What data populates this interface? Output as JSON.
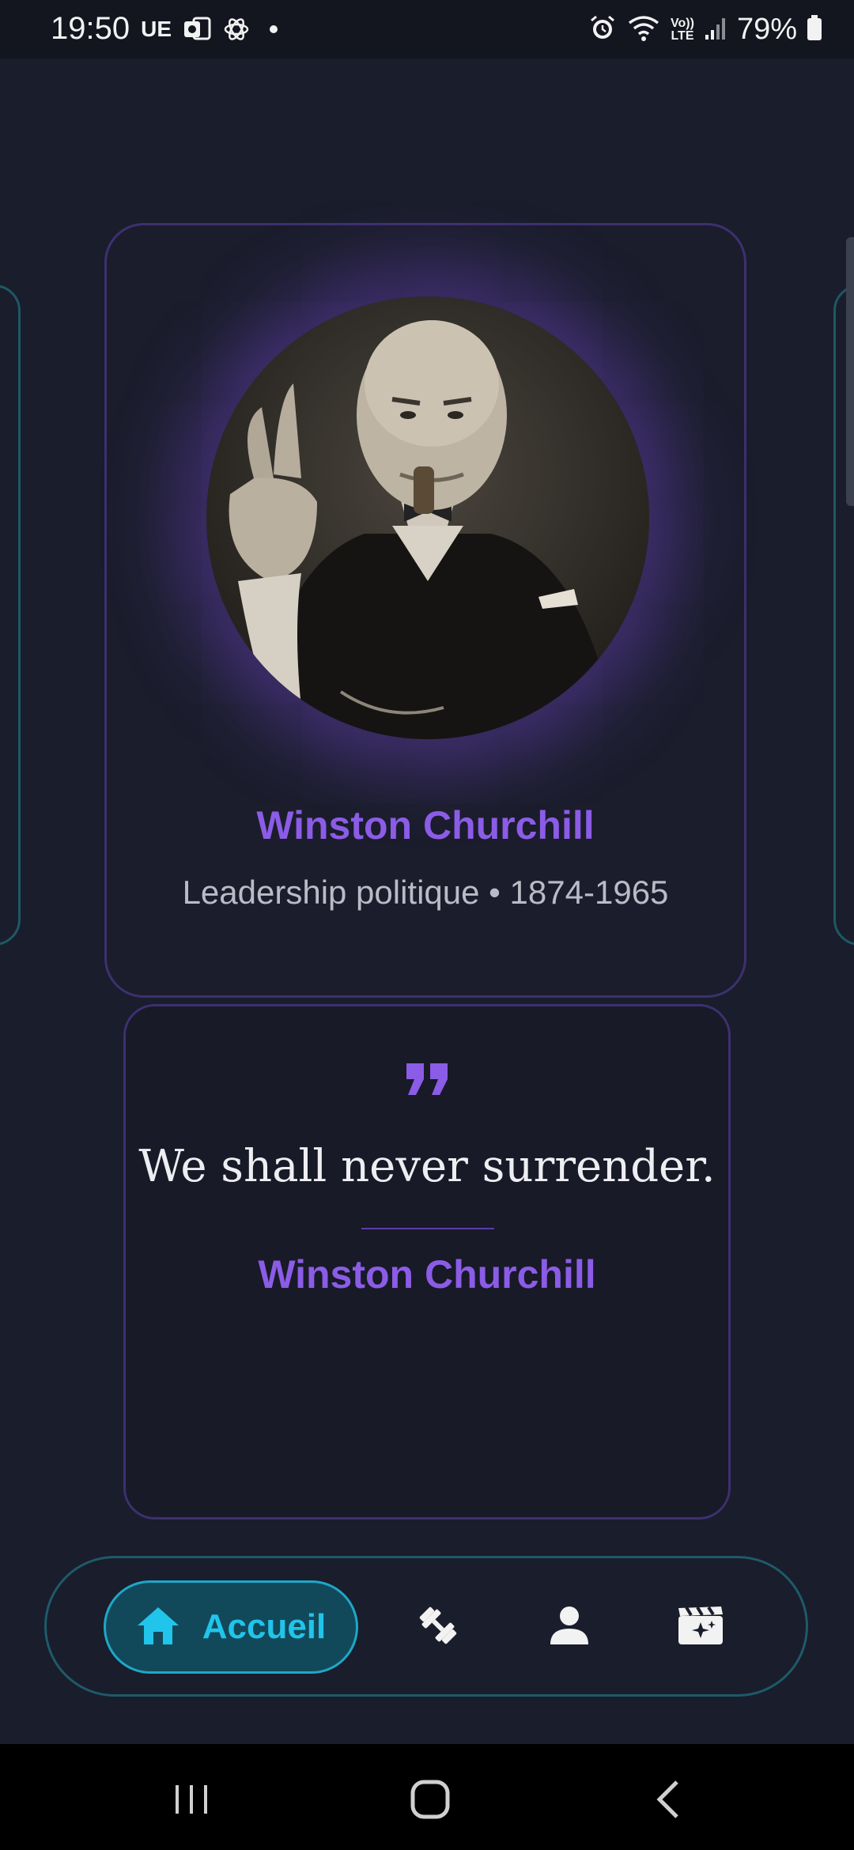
{
  "status_bar": {
    "time": "19:50",
    "carrier": "UE",
    "battery": "79%",
    "icons": [
      "outlook-icon",
      "chatgpt-icon",
      "alarm-icon",
      "wifi-icon",
      "volte-icon",
      "signal-icon",
      "battery-icon"
    ],
    "volte_label_top": "Vo))",
    "volte_label_bottom": "LTE"
  },
  "profile": {
    "name": "Winston Churchill",
    "subtitle": "Leadership politique • 1874-1965"
  },
  "quote": {
    "text": "We shall never surrender.",
    "author": "Winston Churchill"
  },
  "bottom_nav": {
    "items": [
      {
        "label": "Accueil",
        "icon": "home-icon",
        "active": true
      },
      {
        "label": "",
        "icon": "dumbbell-icon",
        "active": false
      },
      {
        "label": "",
        "icon": "person-icon",
        "active": false
      },
      {
        "label": "",
        "icon": "clapperboard-icon",
        "active": false
      }
    ]
  },
  "colors": {
    "background": "#1a1d2b",
    "accent_purple": "#8b5ce6",
    "accent_cyan": "#21c4ea",
    "card_border": "#3d3070"
  }
}
